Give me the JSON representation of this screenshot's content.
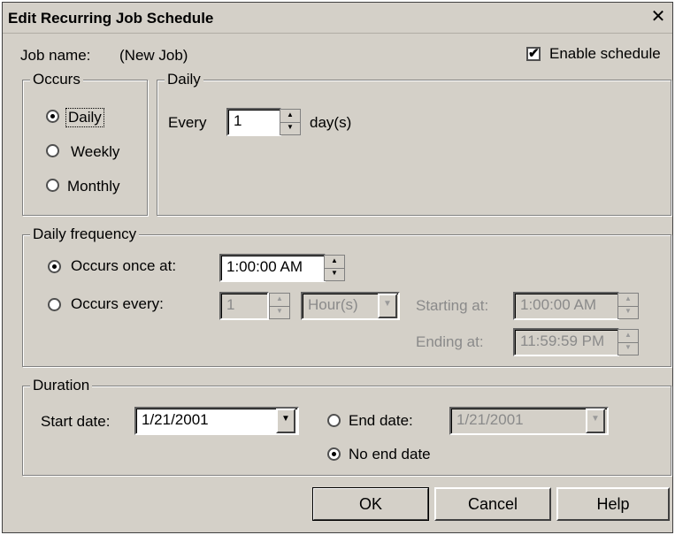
{
  "window": {
    "title": "Edit Recurring Job Schedule",
    "close_glyph": "✕"
  },
  "job": {
    "name_label": "Job name:",
    "name_value": "(New Job)"
  },
  "enable_schedule": {
    "label": "Enable schedule",
    "checked": true
  },
  "occurs": {
    "legend": "Occurs",
    "options": [
      {
        "label": "Daily",
        "selected": true
      },
      {
        "label": "Weekly",
        "selected": false
      },
      {
        "label": "Monthly",
        "selected": false
      }
    ]
  },
  "daily": {
    "legend": "Daily",
    "every_label": "Every",
    "every_value": "1",
    "unit_label": "day(s)"
  },
  "daily_frequency": {
    "legend": "Daily frequency",
    "once_label": "Occurs once at:",
    "once_value": "1:00:00 AM",
    "every_label": "Occurs every:",
    "every_value": "1",
    "every_unit": "Hour(s)",
    "starting_label": "Starting at:",
    "starting_value": "1:00:00 AM",
    "ending_label": "Ending at:",
    "ending_value": "11:59:59 PM"
  },
  "duration": {
    "legend": "Duration",
    "start_label": "Start date:",
    "start_value": "1/21/2001",
    "end_label": "End date:",
    "end_value": "1/21/2001",
    "no_end_label": "No end date"
  },
  "buttons": {
    "ok": "OK",
    "cancel": "Cancel",
    "help": "Help"
  },
  "icons": {
    "checkmark": "✔",
    "spin_up": "▲",
    "spin_down": "▼",
    "dropdown": "▼"
  }
}
